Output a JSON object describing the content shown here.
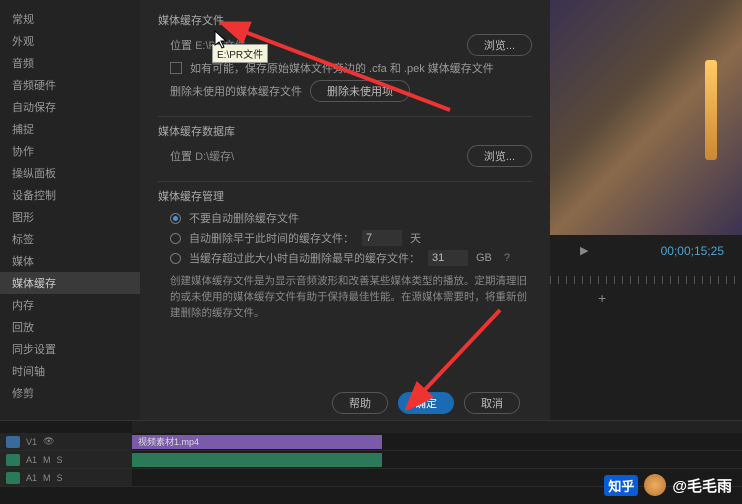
{
  "sidebar": {
    "items": [
      {
        "label": "常规"
      },
      {
        "label": "外观"
      },
      {
        "label": "音频"
      },
      {
        "label": "音频硬件"
      },
      {
        "label": "自动保存"
      },
      {
        "label": "捕捉"
      },
      {
        "label": "协作"
      },
      {
        "label": "操纵面板"
      },
      {
        "label": "设备控制"
      },
      {
        "label": "图形"
      },
      {
        "label": "标签"
      },
      {
        "label": "媒体"
      },
      {
        "label": "媒体缓存"
      },
      {
        "label": "内存"
      },
      {
        "label": "回放"
      },
      {
        "label": "同步设置"
      },
      {
        "label": "时间轴"
      },
      {
        "label": "修剪"
      }
    ],
    "active_index": 12
  },
  "cache_files": {
    "title": "媒体缓存文件",
    "loc_label": "位置",
    "loc_value": "E:\\PR文件",
    "browse": "浏览...",
    "checkbox_label": "如有可能，保存原始媒体文件旁边的 .cfa 和 .pek 媒体缓存文件",
    "delete_label": "删除未使用的媒体缓存文件",
    "delete_btn": "删除未使用项"
  },
  "cache_db": {
    "title": "媒体缓存数据库",
    "loc_label": "位置",
    "loc_value": "D:\\缓存\\",
    "browse": "浏览..."
  },
  "cache_mgmt": {
    "title": "媒体缓存管理",
    "opt1": "不要自动删除缓存文件",
    "opt2_pre": "自动删除早于此时间的缓存文件：",
    "opt2_val": "7",
    "opt2_unit": "天",
    "opt3_pre": "当缓存超过此大小时自动删除最早的缓存文件：",
    "opt3_val": "31",
    "opt3_unit": "GB",
    "desc": "创建媒体缓存文件是为显示音频波形和改善某些媒体类型的播放。定期清理旧的或未使用的媒体缓存文件有助于保持最佳性能。在源媒体需要时，将重新创建删除的缓存文件。"
  },
  "tooltip": "E:\\PR文件",
  "buttons": {
    "help": "帮助",
    "ok": "确定",
    "cancel": "取消"
  },
  "preview": {
    "timecode": "00;00;15;25",
    "clip_name": "视频素材1.mp4",
    "tracks": [
      {
        "name": "V1"
      },
      {
        "name": "A1"
      },
      {
        "name": "A1"
      }
    ]
  },
  "watermark": {
    "logo": "知乎",
    "author": "@毛毛雨"
  },
  "icons": {
    "question": "?"
  }
}
